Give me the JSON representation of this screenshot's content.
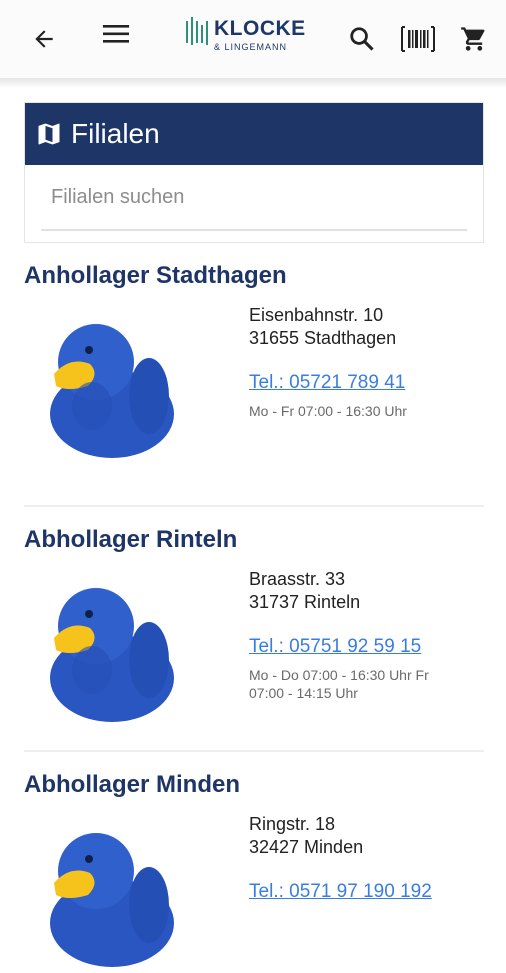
{
  "header": {
    "logo_main": "KLOCKE",
    "logo_sub": "& LINGEMANN"
  },
  "card": {
    "title": "Filialen",
    "search_placeholder": "Filialen suchen"
  },
  "stores": [
    {
      "name": "Anhollager Stadthagen",
      "street": "Eisenbahnstr. 10",
      "city": "31655 Stadthagen",
      "phone": "Tel.: 05721 789 41",
      "hours": "Mo - Fr 07:00 - 16:30 Uhr"
    },
    {
      "name": "Abhollager Rinteln",
      "street": "Braasstr. 33",
      "city": "31737 Rinteln",
      "phone": "Tel.: 05751 92 59 15",
      "hours": "Mo - Do 07:00 - 16:30 Uhr Fr 07:00 - 14:15 Uhr"
    },
    {
      "name": "Abhollager Minden",
      "street": "Ringstr. 18",
      "city": "32427 Minden",
      "phone": "Tel.: 0571 97 190 192",
      "hours": ""
    }
  ],
  "colors": {
    "brand_navy": "#1e3567",
    "link_blue": "#3a7de0",
    "logo_teal": "#2e8f7b"
  }
}
